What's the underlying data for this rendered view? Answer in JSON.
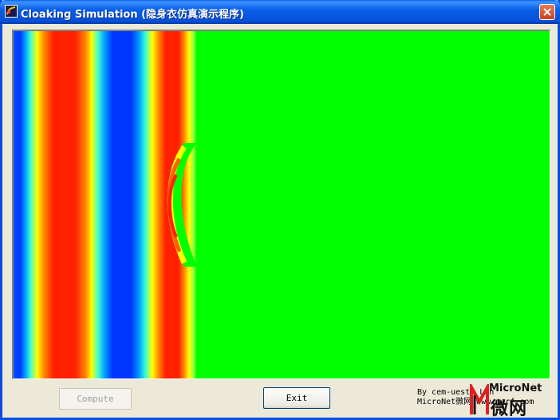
{
  "window": {
    "title": "Cloaking Simulation (隐身衣仿真演示程序)"
  },
  "icons": {
    "app": "app-icon",
    "close": "close-icon"
  },
  "buttons": {
    "compute_label": "Compute",
    "exit_label": "Exit"
  },
  "credits": {
    "line1": "By cem-uestc Lin",
    "line2": "MicroNet微网 www.mwrf.com"
  },
  "watermark": {
    "brand": "MicroNet",
    "chinese": "微网"
  },
  "colors": {
    "field_background": "#00ff00",
    "title_bar": "#0a5fe8",
    "close_button": "#d9532c"
  }
}
